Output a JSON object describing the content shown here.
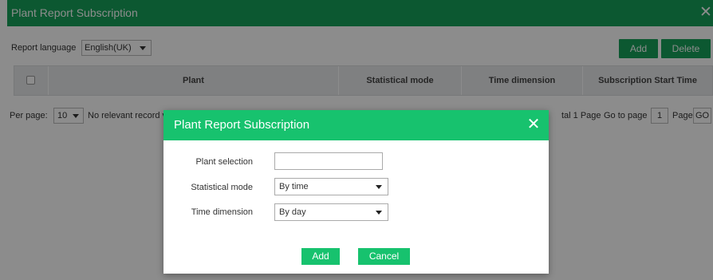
{
  "window": {
    "title": "Plant Report Subscription",
    "close_glyph": "✕"
  },
  "toolbar": {
    "language_label": "Report language",
    "language_value": "English(UK)",
    "add_label": "Add",
    "delete_label": "Delete"
  },
  "table": {
    "columns": [
      "Plant",
      "Statistical mode",
      "Time dimension",
      "Subscription Start Time"
    ]
  },
  "pager": {
    "per_page_label": "Per page:",
    "per_page_value": "10",
    "no_record_text": "No relevant record v",
    "total_text": "tal 1 Page",
    "goto_label": "Go to page",
    "goto_value": "1",
    "page_label": "Page",
    "go_label": "GO"
  },
  "modal": {
    "title": "Plant Report Subscription",
    "close_glyph": "✕",
    "fields": {
      "plant_label": "Plant selection",
      "plant_value": "",
      "mode_label": "Statistical mode",
      "mode_value": "By time",
      "time_label": "Time dimension",
      "time_value": "By day"
    },
    "add_label": "Add",
    "cancel_label": "Cancel"
  },
  "colors": {
    "window_header": "#16a05a",
    "modal_header": "#17c26e",
    "button": "#16a05a"
  },
  "icons": {
    "close": "close-icon",
    "dropdown": "chevron-down-icon",
    "checkbox": "checkbox-icon"
  }
}
